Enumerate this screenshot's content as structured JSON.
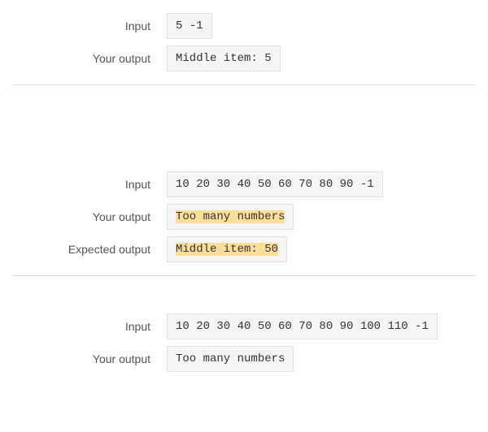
{
  "labels": {
    "input": "Input",
    "your_output": "Your output",
    "expected_output": "Expected output"
  },
  "case1": {
    "input": "5 -1",
    "your_output": "Middle item: 5"
  },
  "case2": {
    "input": "10 20 30 40 50 60 70 80 90 -1",
    "your_output_highlighted": "Too many numbers",
    "expected_pre": "Middle item: ",
    "expected_hl": "50"
  },
  "case3": {
    "input": "10 20 30 40 50 60 70 80 90 100 110 -1",
    "your_output": "Too many numbers"
  }
}
